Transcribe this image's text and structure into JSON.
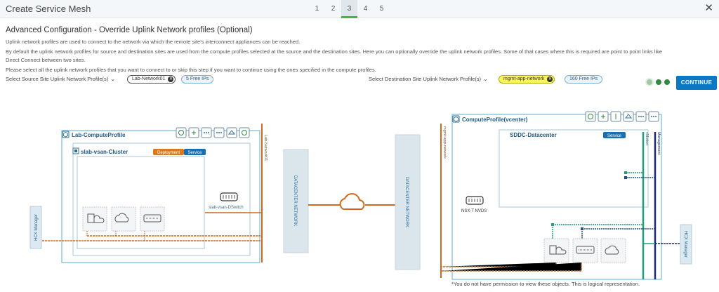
{
  "window": {
    "title": "Create Service Mesh",
    "steps": [
      "1",
      "2",
      "3",
      "4",
      "5"
    ],
    "active_step": "3",
    "close_glyph": "✕"
  },
  "page": {
    "heading": "Advanced Configuration - Override Uplink Network profiles (Optional)",
    "desc_1": "Uplink network profiles are used to connect to the network via which the remote site's interconnect appliances can be reached.",
    "desc_2": "By default the uplink network profiles for source and destination sites are used from the compute profiles selected at the source and the destination sites. Here you can optionally override the uplink network profiles. Some of that cases where this is required are point to point links like",
    "desc_3": "Direct Connect between two sites.",
    "desc_4": "Please select all the uplink network profiles that you want to connect to or skip this step if you want to continue using the ones specified in the compute profiles."
  },
  "source": {
    "label": "Select Source Site Uplink Network Profile(s)",
    "chip": "Lab-Network01",
    "badge": "5 Free IPs"
  },
  "destination": {
    "label": "Select Destination Site Uplink Network Profile(s)",
    "chip": "mgmt-app-network",
    "badge": "160 Free IPs"
  },
  "actions": {
    "continue": "CONTINUE"
  },
  "diagram": {
    "left_profile": "Lab-ComputeProfile",
    "left_cluster": "slab-vsan-Cluster",
    "deployment_tag": "Deployment",
    "service_tag": "Service",
    "left_switch": "slab-vsan-DSwitch",
    "left_manager": "HCX Manager",
    "left_network": "Lab-Network01",
    "dc_network_left": "DATACENTER NETWORK",
    "dc_network_right": "DATACENTER NETWORK",
    "right_network": "mgmt-app-network",
    "right_profile": "ComputeProfile(vcenter)",
    "right_dc": "SDDC-Datacenter",
    "right_service_tag": "Service",
    "vmotion_label": "vMotion",
    "management_label": "Management",
    "nsx_label": "NSX-T NVDS",
    "right_manager": "HCX Manager"
  },
  "footnote": "*You do not have permission to view these objects. This is logical representation.",
  "colors": {
    "accent": "#0a78c2",
    "orange": "#d2691e",
    "teal": "#1f9e83",
    "navy": "#1c2a73",
    "dotted_blue": "#1d4f91",
    "green": "#2d8a3e",
    "profile_border": "#5aaed2"
  },
  "icons": {
    "close": "close-icon",
    "switch": "switch-icon",
    "cloud": "cloud-icon",
    "progress": "progress-dots-icon"
  }
}
